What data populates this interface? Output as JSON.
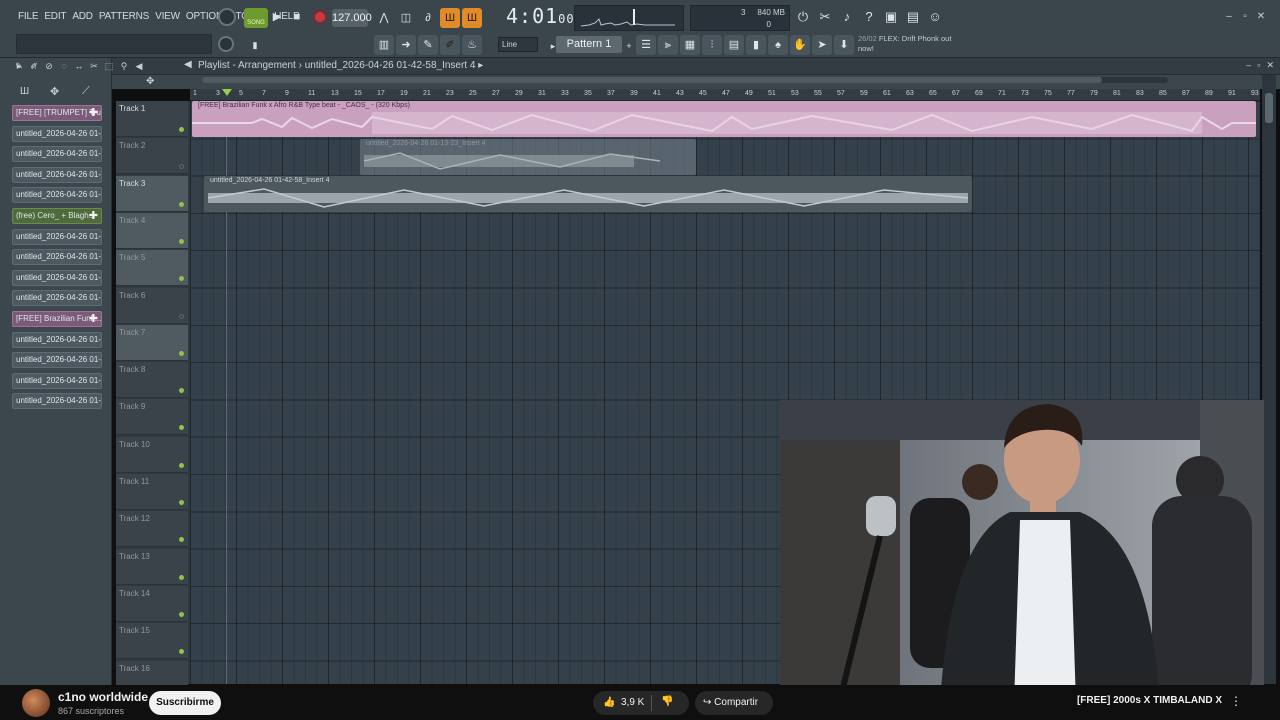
{
  "menu": [
    "FILE",
    "EDIT",
    "ADD",
    "PATTERNS",
    "VIEW",
    "OPTIONS",
    "TOOLS",
    "HELP"
  ],
  "transport": {
    "song_label": "SONG",
    "tempo": "127.000",
    "time_main": "4:01",
    "time_sub": "00"
  },
  "cpu": {
    "top_value": "3",
    "memory": "840 MB",
    "bottom_value": "0"
  },
  "toolbar": {
    "snap": "Line",
    "pattern": "Pattern 1"
  },
  "news": {
    "date": "26/02",
    "text": "FLEX: Drift Phonk out now!"
  },
  "playlist": {
    "title": "Playlist - Arrangement",
    "breadcrumb_sep": "›",
    "breadcrumb": "untitled_2026-04-26 01-42-58_Insert 4",
    "ruler_numbers": [
      "1",
      "3",
      "5",
      "7",
      "9",
      "11",
      "13",
      "15",
      "17",
      "19",
      "21",
      "23",
      "25",
      "27",
      "29",
      "31",
      "33",
      "35",
      "37",
      "39",
      "41",
      "43",
      "45",
      "47",
      "49",
      "51",
      "53",
      "55",
      "57",
      "59",
      "61",
      "63",
      "65",
      "67",
      "69",
      "71",
      "73",
      "75",
      "77",
      "79",
      "81",
      "83",
      "85",
      "87",
      "89",
      "91",
      "93"
    ],
    "tracks": [
      "Track 1",
      "Track 2",
      "Track 3",
      "Track 4",
      "Track 5",
      "Track 6",
      "Track 7",
      "Track 8",
      "Track 9",
      "Track 10",
      "Track 11",
      "Track 12",
      "Track 13",
      "Track 14",
      "Track 15",
      "Track 16"
    ],
    "clips": [
      {
        "label": "[FREE] Brazilian Funk x Afro R&B Type beat - _CAOS_ - (320 Kbps)"
      },
      {
        "label": "untitled_2026-04-26 01-13-23_Insert 4"
      },
      {
        "label": "untitled_2026-04-26 01-42-58_Insert 4"
      }
    ]
  },
  "browser_items": [
    {
      "label": "[FREE] [TRUMPET] Tru...",
      "kind": "pink"
    },
    {
      "label": "untitled_2026-04-26 01-...",
      "kind": "plain"
    },
    {
      "label": "untitled_2026-04-26 01-...",
      "kind": "plain"
    },
    {
      "label": "untitled_2026-04-26 01-...",
      "kind": "plain"
    },
    {
      "label": "untitled_2026-04-26 01-...",
      "kind": "plain"
    },
    {
      "label": "(free) Cero_ + Blagh...",
      "kind": "green"
    },
    {
      "label": "untitled_2026-04-26 01-...",
      "kind": "plain"
    },
    {
      "label": "untitled_2026-04-26 01-...",
      "kind": "plain"
    },
    {
      "label": "untitled_2026-04-26 01-...",
      "kind": "plain"
    },
    {
      "label": "untitled_2026-04-26 01-...",
      "kind": "plain"
    },
    {
      "label": "[FREE] Brazilian Funk...",
      "kind": "pink"
    },
    {
      "label": "untitled_2026-04-26 01-...",
      "kind": "plain"
    },
    {
      "label": "untitled_2026-04-26 01-...",
      "kind": "plain"
    },
    {
      "label": "untitled_2026-04-26 01-...",
      "kind": "plain"
    },
    {
      "label": "untitled_2026-04-26 01-...",
      "kind": "plain"
    }
  ],
  "youtube": {
    "channel": "c1no worldwide",
    "subscribers": "867 suscriptores",
    "subscribe": "Suscribirme",
    "likes": "3,9 K",
    "share": "Compartir",
    "next_video": "[FREE] 2000s X TIMBALAND X"
  },
  "colors": {
    "accent_orange": "#e08b2a",
    "clip_pink": "#c9a1bf",
    "clip_gray": "#9aa3a8",
    "led_green": "#8fc34a",
    "record_red": "#c33a44"
  }
}
